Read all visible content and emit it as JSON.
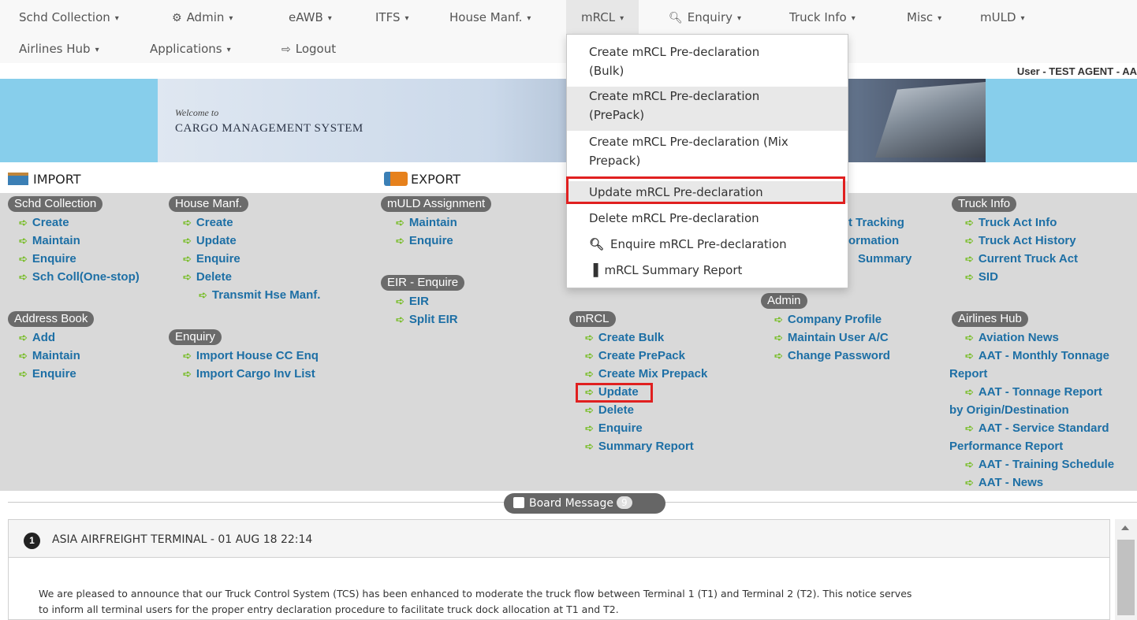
{
  "nav": {
    "items": [
      {
        "label": "Schd Collection",
        "caret": "▾"
      },
      {
        "label": "Admin",
        "caret": "▾",
        "icon": "gear-icon"
      },
      {
        "label": "eAWB",
        "caret": "▾"
      },
      {
        "label": "ITFS",
        "caret": "▾"
      },
      {
        "label": "House Manf.",
        "caret": "▾"
      },
      {
        "label": "mRCL",
        "caret": "▾"
      },
      {
        "label": "Enquiry",
        "caret": "▾",
        "icon": "search-icon"
      },
      {
        "label": "Truck Info",
        "caret": "▾"
      },
      {
        "label": "Misc",
        "caret": "▾"
      },
      {
        "label": "mULD",
        "caret": "▾"
      },
      {
        "label": "Airlines Hub",
        "caret": "▾"
      },
      {
        "label": "Applications",
        "caret": "▾"
      },
      {
        "label": "Logout",
        "icon": "logout-icon"
      }
    ]
  },
  "user": {
    "text": "User - TEST AGENT - AA"
  },
  "banner": {
    "welcome": "Welcome to",
    "title": "CARGO MANAGEMENT SYSTEM"
  },
  "sections": {
    "import": "IMPORT",
    "export": "EXPORT"
  },
  "groups": {
    "schd_collection": {
      "label": "Schd Collection",
      "links": [
        "Create",
        "Maintain",
        "Enquire",
        "Sch Coll(One-stop)"
      ]
    },
    "address_book": {
      "label": "Address Book",
      "links": [
        "Add",
        "Maintain",
        "Enquire"
      ]
    },
    "house_manf": {
      "label": "House Manf.",
      "links": [
        "Create",
        "Update",
        "Enquire",
        "Delete",
        "Transmit Hse Manf."
      ]
    },
    "enquiry": {
      "label": "Enquiry",
      "links": [
        "Import House CC Enq",
        "Import Cargo Inv List"
      ]
    },
    "muld": {
      "label": "mULD Assignment",
      "links": [
        "Maintain",
        "Enquire"
      ]
    },
    "eir": {
      "label": "EIR - Enquire",
      "links": [
        "EIR",
        "Split EIR"
      ]
    },
    "mrcl": {
      "label": "mRCL",
      "links": [
        "Create Bulk",
        "Create PrePack",
        "Create Mix Prepack",
        "Update",
        "Delete",
        "Enquire",
        "Summary Report"
      ]
    },
    "partial": {
      "links": [
        "t Tracking",
        "ormation",
        "Summary"
      ]
    },
    "admin": {
      "label": "Admin",
      "links": [
        "Company Profile",
        "Maintain User A/C",
        "Change Password"
      ]
    },
    "truck_info": {
      "label": "Truck Info",
      "links": [
        "Truck Act Info",
        "Truck Act History",
        "Current Truck Act",
        "SID"
      ]
    },
    "airlines_hub": {
      "label": "Airlines Hub",
      "links": [
        "Aviation News",
        "AAT - Monthly Tonnage",
        "AAT - Tonnage Report",
        "AAT - Service Standard",
        "AAT - Training Schedule",
        "AAT - News"
      ],
      "wraps": [
        "Report",
        "by Origin/Destination",
        "Performance Report"
      ]
    }
  },
  "dropdown": {
    "items": [
      {
        "label": "Create mRCL Pre-declaration",
        "label2": "(Bulk)"
      },
      {
        "label": "Create mRCL Pre-declaration",
        "label2": "(PrePack)"
      },
      {
        "label": "Create mRCL Pre-declaration (Mix",
        "label2": "Prepack)"
      },
      {
        "label": "Update mRCL Pre-declaration"
      },
      {
        "label": "Delete mRCL Pre-declaration"
      },
      {
        "label": "Enquire mRCL Pre-declaration",
        "icon": "search-icon"
      },
      {
        "label": "mRCL Summary Report",
        "icon": "bar-chart-icon"
      }
    ]
  },
  "board": {
    "label": "Board Message",
    "count": "9"
  },
  "message": {
    "number": "1",
    "title": "ASIA AIRFREIGHT TERMINAL - 01 AUG 18 22:14",
    "body1": "We are pleased to announce that our Truck Control System (TCS) has been enhanced to moderate the truck flow between Terminal 1 (T1) and Terminal 2 (T2). This notice serves",
    "body2": "to inform all terminal users for the proper entry declaration procedure to facilitate truck dock allocation at T1 and T2."
  },
  "colors": {
    "accent": "#1d6fa5",
    "highlight": "#e02020",
    "panel": "#d9d9d9",
    "arrow": "#7cbe2f"
  }
}
